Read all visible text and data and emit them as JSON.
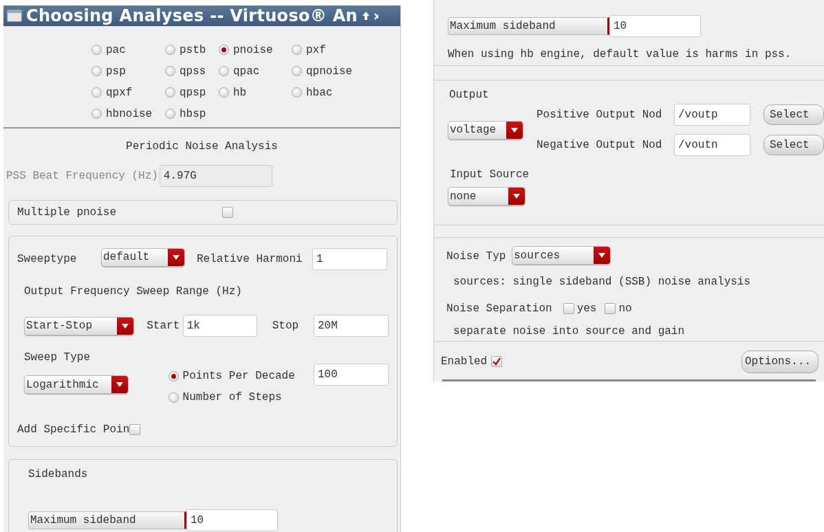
{
  "left_window": {
    "title": "Choosing Analyses -- Virtuoso® An",
    "analyses": [
      {
        "label": "pac",
        "selected": false
      },
      {
        "label": "pstb",
        "selected": false
      },
      {
        "label": "pnoise",
        "selected": true
      },
      {
        "label": "pxf",
        "selected": false
      },
      {
        "label": "psp",
        "selected": false
      },
      {
        "label": "qpss",
        "selected": false
      },
      {
        "label": "qpac",
        "selected": false
      },
      {
        "label": "qpnoise",
        "selected": false
      },
      {
        "label": "qpxf",
        "selected": false
      },
      {
        "label": "qpsp",
        "selected": false
      },
      {
        "label": "hb",
        "selected": false
      },
      {
        "label": "hbac",
        "selected": false
      },
      {
        "label": "hbnoise",
        "selected": false
      },
      {
        "label": "hbsp",
        "selected": false
      }
    ],
    "section_title": "Periodic Noise Analysis",
    "beat_frequency": {
      "label": "PSS Beat Frequency (Hz)",
      "value": "4.97G",
      "disabled": true
    },
    "multiple_pnoise": {
      "label": "Multiple pnoise",
      "checked": false
    },
    "sweep": {
      "sweeptype": {
        "label": "Sweeptype",
        "value": "default"
      },
      "relative_harmonic": {
        "label": "Relative Harmoni",
        "value": "1"
      },
      "range_label": "Output Frequency Sweep Range (Hz)",
      "range": {
        "value": "Start-Stop",
        "start_label": "Start",
        "start": "1k",
        "stop_label": "Stop",
        "stop": "20M"
      },
      "sweep_type": {
        "label": "Sweep Type",
        "value": "Logarithmic"
      },
      "step_modes": [
        {
          "label": "Points Per Decade",
          "selected": true
        },
        {
          "label": "Number of Steps",
          "selected": false
        }
      ],
      "step_value": "100",
      "specific_points": {
        "label": "Add Specific Poin",
        "checked": false
      }
    },
    "sidebands": {
      "title": "Sidebands",
      "maximum_sideband": {
        "label": "Maximum sideband",
        "value": "10"
      }
    }
  },
  "right_window": {
    "maximum_sideband": {
      "label": "Maximum sideband",
      "value": "10"
    },
    "sideband_note": "When using hb engine, default value is harms in pss.",
    "output": {
      "label": "Output",
      "type": "voltage",
      "nodes": [
        {
          "label": "Positive Output Nod",
          "value": "/voutp",
          "button": "Select"
        },
        {
          "label": "Negative Output Nod",
          "value": "/voutn",
          "button": "Select"
        }
      ],
      "input_source_label": "Input Source",
      "input_source": "none"
    },
    "noise": {
      "type_label": "Noise Typ",
      "type": "sources",
      "description": "sources: single sideband (SSB) noise analysis",
      "separation_label": "Noise Separation",
      "separation_options": [
        {
          "label": "yes",
          "checked": false
        },
        {
          "label": "no",
          "checked": false
        }
      ],
      "separation_note": "separate noise into source and gain"
    },
    "enabled": {
      "label": "Enabled",
      "checked": true
    },
    "options_button": "Options..."
  }
}
